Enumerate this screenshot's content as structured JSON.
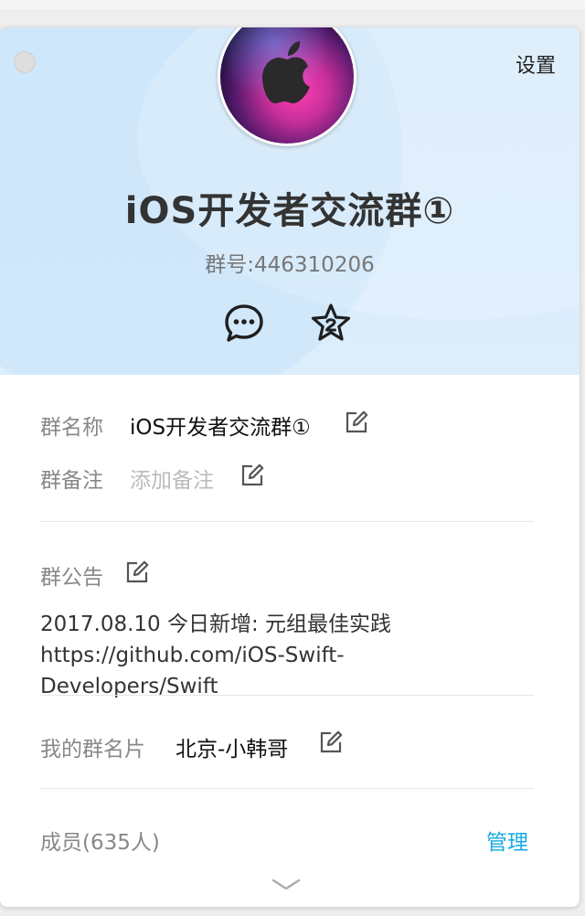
{
  "header": {
    "settings_label": "设置",
    "group_name": "iOS开发者交流群①",
    "group_number": "群号:446310206"
  },
  "info": {
    "name_label": "群名称",
    "name_value": "iOS开发者交流群①",
    "remark_label": "群备注",
    "remark_placeholder": "添加备注",
    "notice_label": "群公告",
    "notice_text": "2017.08.10 今日新增: 元组最佳实践 https://github.com/iOS-Swift-Developers/Swift",
    "card_label": "我的群名片",
    "card_value": "北京-小韩哥",
    "members_label": "成员(635人)",
    "manage_label": "管理"
  },
  "icons": {
    "chat": "chat-bubble-icon",
    "favorite": "star-icon",
    "edit": "edit-icon",
    "expand": "chevron-down-icon"
  },
  "colors": {
    "header_bg": "#d7ebfb",
    "link": "#1aabe6"
  }
}
